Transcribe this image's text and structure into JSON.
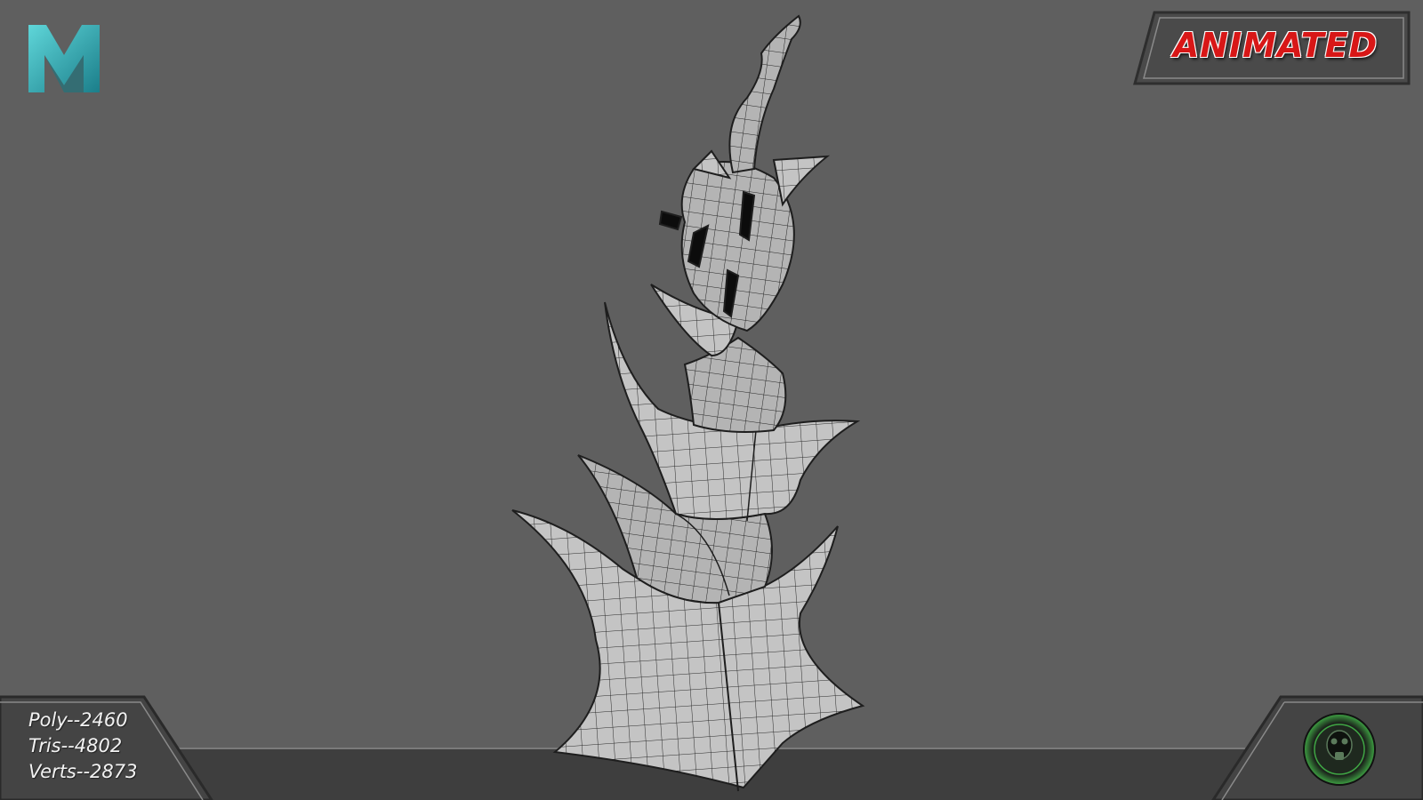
{
  "app_logo": {
    "icon": "maya-m-logo",
    "color": "#2aa6b0"
  },
  "badge": {
    "label": "ANIMATED",
    "color": "#d81717"
  },
  "mesh_stats": {
    "poly": "Poly--2460",
    "tris": "Tris--4802",
    "verts": "Verts--2873"
  },
  "viewport": {
    "model": "spiky-tower-wireframe",
    "background": "#5f5f5f"
  },
  "emblem": {
    "icon": "gas-mask-emblem-icon",
    "color": "#3fa644"
  }
}
